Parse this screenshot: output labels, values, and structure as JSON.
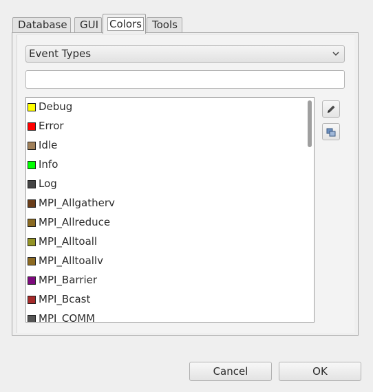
{
  "tabs": [
    {
      "label": "Database",
      "active": false
    },
    {
      "label": "GUI",
      "active": false
    },
    {
      "label": "Colors",
      "active": true
    },
    {
      "label": "Tools",
      "active": false
    }
  ],
  "category_select": {
    "value": "Event Types"
  },
  "filter_input": {
    "value": ""
  },
  "event_list": [
    {
      "label": "Debug",
      "color": "#ffff00"
    },
    {
      "label": "Error",
      "color": "#ff0000"
    },
    {
      "label": "Idle",
      "color": "#a0805a"
    },
    {
      "label": "Info",
      "color": "#00ff00"
    },
    {
      "label": "Log",
      "color": "#444444"
    },
    {
      "label": "MPI_Allgatherv",
      "color": "#6a3e1a"
    },
    {
      "label": "MPI_Allreduce",
      "color": "#8a6a22"
    },
    {
      "label": "MPI_Alltoall",
      "color": "#939325"
    },
    {
      "label": "MPI_Alltoallv",
      "color": "#8c6a22"
    },
    {
      "label": "MPI_Barrier",
      "color": "#7d0a7d"
    },
    {
      "label": "MPI_Bcast",
      "color": "#a52a2a"
    },
    {
      "label": "MPI_COMM",
      "color": "#555555"
    }
  ],
  "side_buttons": {
    "edit_icon": "pencil-icon",
    "reset_icon": "swap-colors-icon"
  },
  "buttons": {
    "cancel": "Cancel",
    "ok": "OK"
  }
}
